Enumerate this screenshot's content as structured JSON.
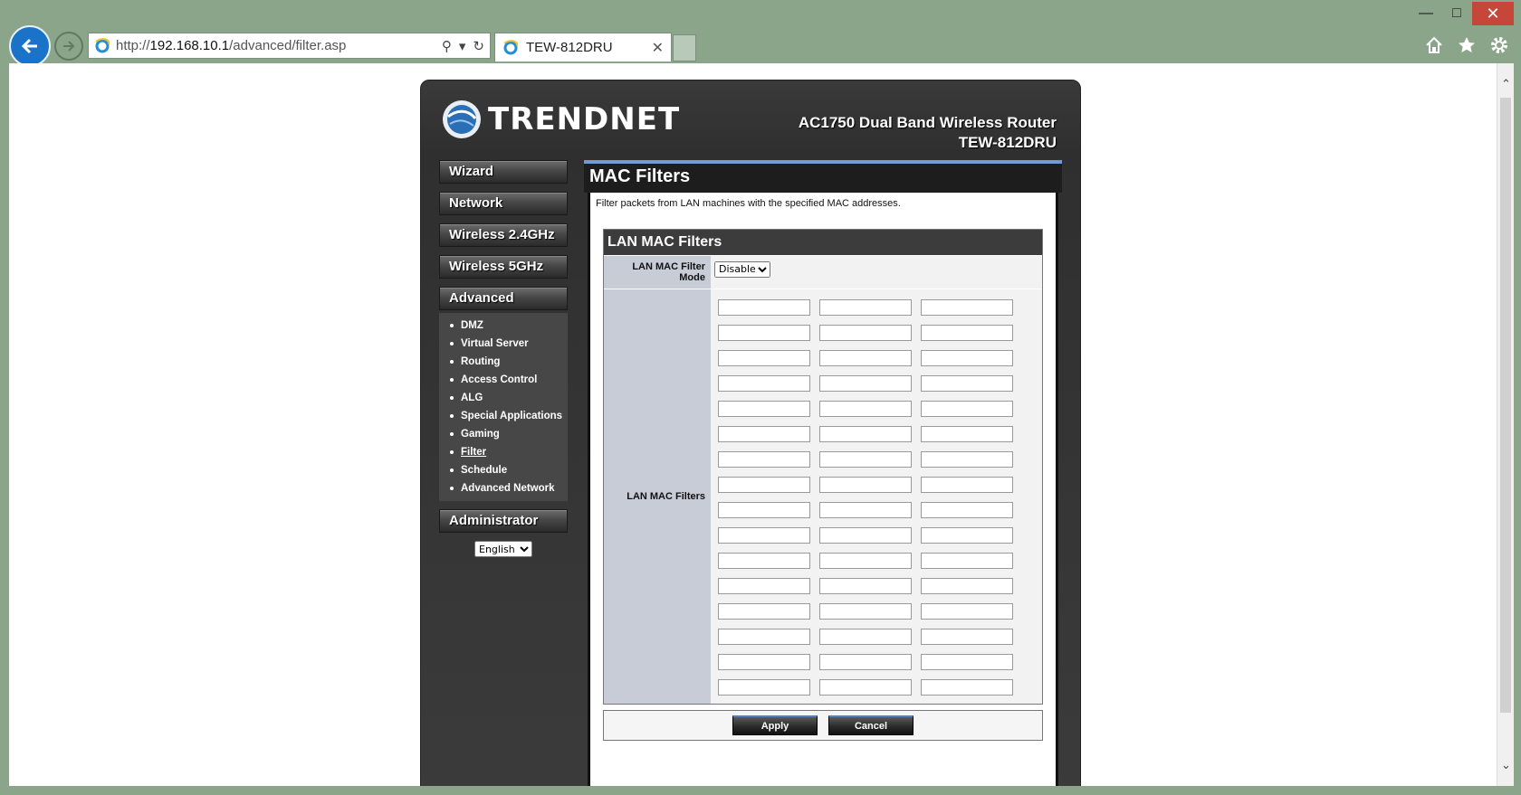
{
  "browser": {
    "url_prefix": "http://",
    "url_host": "192.168.10.1",
    "url_path": "/advanced/filter.asp",
    "tab_title": "TEW-812DRU"
  },
  "router": {
    "brand": "TRENDNET",
    "product_line": "AC1750 Dual Band Wireless Router",
    "model": "TEW-812DRU"
  },
  "nav": {
    "wizard": "Wizard",
    "network": "Network",
    "wireless24": "Wireless 2.4GHz",
    "wireless5": "Wireless 5GHz",
    "advanced": "Advanced",
    "administrator": "Administrator",
    "advanced_items": [
      "DMZ",
      "Virtual Server",
      "Routing",
      "Access Control",
      "ALG",
      "Special Applications",
      "Gaming",
      "Filter",
      "Schedule",
      "Advanced Network"
    ],
    "active_item": "Filter",
    "language": "English"
  },
  "page": {
    "title": "MAC Filters",
    "description": "Filter packets from LAN machines with the specified MAC addresses.",
    "section_title": "LAN MAC Filters",
    "mode_label": "LAN MAC Filter Mode",
    "mode_value": "Disabled",
    "filters_label": "LAN MAC Filters",
    "filter_rows": 16,
    "filter_cols": 3,
    "apply": "Apply",
    "cancel": "Cancel"
  },
  "colors": {
    "accent_bar": "#6f9bd9",
    "label_bg": "#c7ccd6",
    "ie_blue": "#1a73c9"
  },
  "icons": [
    "back-arrow-icon",
    "forward-arrow-icon",
    "ie-logo-icon",
    "search-icon",
    "refresh-icon",
    "home-icon",
    "star-icon",
    "gear-icon",
    "close-icon",
    "minimize-icon",
    "maximize-icon"
  ]
}
